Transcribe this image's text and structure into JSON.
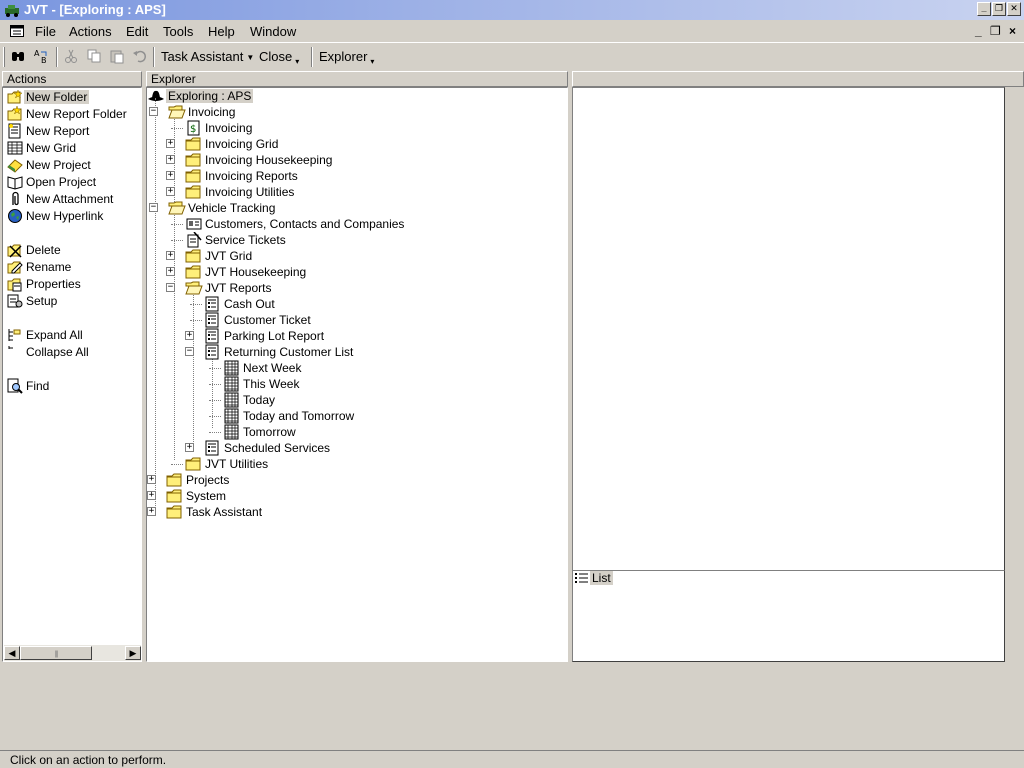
{
  "window": {
    "title": "JVT - [Exploring : APS]"
  },
  "menu": {
    "items": [
      {
        "name": "menu-file",
        "label": "File"
      },
      {
        "name": "menu-actions",
        "label": "Actions"
      },
      {
        "name": "menu-edit",
        "label": "Edit"
      },
      {
        "name": "menu-tools",
        "label": "Tools"
      },
      {
        "name": "menu-help",
        "label": "Help"
      },
      {
        "name": "menu-window",
        "label": "Window"
      }
    ]
  },
  "toolbar": {
    "task_assistant": "Task Assistant",
    "close": "Close",
    "explorer": "Explorer"
  },
  "actions": {
    "header": "Actions",
    "items": [
      {
        "label": "New Folder",
        "icon": "new-folder-icon"
      },
      {
        "label": "New Report Folder",
        "icon": "new-report-folder-icon"
      },
      {
        "label": "New Report",
        "icon": "new-report-icon"
      },
      {
        "label": "New Grid",
        "icon": "new-grid-icon"
      },
      {
        "label": "New Project",
        "icon": "new-project-icon"
      },
      {
        "label": "Open Project",
        "icon": "open-project-icon"
      },
      {
        "label": "New Attachment",
        "icon": "attachment-icon"
      },
      {
        "label": "New Hyperlink",
        "icon": "hyperlink-icon"
      },
      {
        "label": "Delete",
        "icon": "delete-icon"
      },
      {
        "label": "Rename",
        "icon": "rename-icon"
      },
      {
        "label": "Properties",
        "icon": "properties-icon"
      },
      {
        "label": "Setup",
        "icon": "setup-icon"
      },
      {
        "label": "Expand All",
        "icon": "expand-all-icon"
      },
      {
        "label": "Collapse All",
        "icon": "collapse-all-icon"
      },
      {
        "label": "Find",
        "icon": "find-icon"
      }
    ]
  },
  "explorer": {
    "header": "Explorer",
    "root": "Exploring : APS",
    "nodes": [
      {
        "label": "Invoicing"
      },
      {
        "label": "Invoicing"
      },
      {
        "label": "Invoicing Grid"
      },
      {
        "label": "Invoicing Housekeeping"
      },
      {
        "label": "Invoicing Reports"
      },
      {
        "label": "Invoicing Utilities"
      },
      {
        "label": "Vehicle Tracking"
      },
      {
        "label": "Customers, Contacts and Companies"
      },
      {
        "label": "Service Tickets"
      },
      {
        "label": "JVT Grid"
      },
      {
        "label": "JVT Housekeeping"
      },
      {
        "label": "JVT Reports"
      },
      {
        "label": "Cash Out"
      },
      {
        "label": "Customer Ticket"
      },
      {
        "label": "Parking Lot Report"
      },
      {
        "label": "Returning Customer List"
      },
      {
        "label": "Next Week"
      },
      {
        "label": "This Week"
      },
      {
        "label": "Today"
      },
      {
        "label": "Today and Tomorrow"
      },
      {
        "label": "Tomorrow"
      },
      {
        "label": "Scheduled Services"
      },
      {
        "label": "JVT Utilities"
      },
      {
        "label": "Projects"
      },
      {
        "label": "System"
      },
      {
        "label": "Task Assistant"
      }
    ]
  },
  "right_pane": {
    "list_label": "List"
  },
  "status": {
    "text": "Click on an action to perform."
  }
}
